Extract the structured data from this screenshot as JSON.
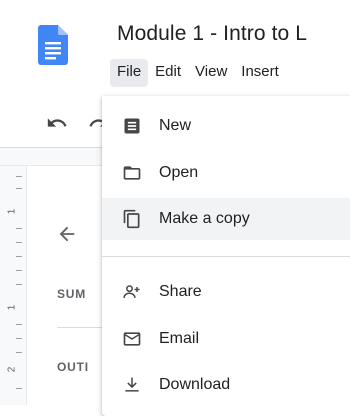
{
  "document": {
    "title": "Module 1 - Intro to L"
  },
  "menubar": {
    "items": [
      {
        "label": "File",
        "active": true
      },
      {
        "label": "Edit"
      },
      {
        "label": "View"
      },
      {
        "label": "Insert"
      }
    ]
  },
  "toolbar": {
    "icons": [
      "undo-icon",
      "redo-icon"
    ]
  },
  "ruler": {
    "labels": [
      "1",
      "1",
      "2"
    ]
  },
  "outline_panel": {
    "labels": [
      "SUM",
      "OUTI"
    ]
  },
  "file_menu": {
    "items": [
      {
        "label": "New",
        "icon": "docs-new-icon"
      },
      {
        "label": "Open",
        "icon": "folder-icon"
      },
      {
        "label": "Make a copy",
        "icon": "copy-icon",
        "hovered": true
      },
      {
        "label": "Share",
        "icon": "add-person-icon"
      },
      {
        "label": "Email",
        "icon": "email-icon"
      },
      {
        "label": "Download",
        "icon": "download-icon"
      }
    ]
  },
  "colors": {
    "docs_blue": "#4285f4",
    "hover_bg": "#f1f3f4",
    "active_menu_bg": "#e8eaed",
    "icon_gray": "#444746"
  }
}
